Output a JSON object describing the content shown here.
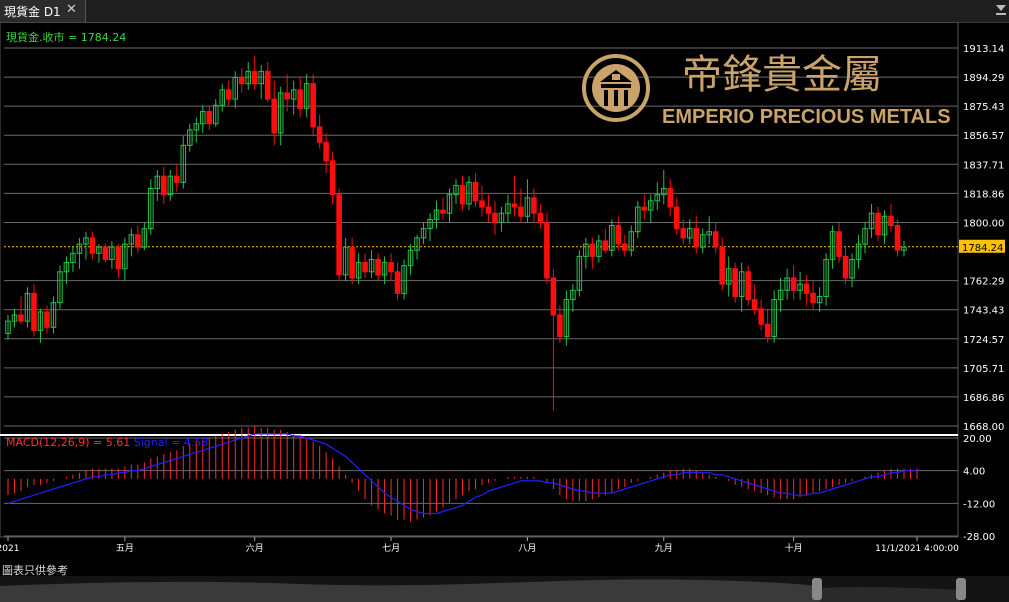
{
  "window": {
    "tab_title": "現貨金 D1",
    "close_glyph": "✕",
    "collapse_icon": "chevron-down-icon"
  },
  "logo": {
    "chinese": "帝鋒貴金屬",
    "english": "EMPERIO PRECIOUS METALS",
    "color": "#c9a36a"
  },
  "disclaimer": "圖表只供參考",
  "colors": {
    "up": "#22c24a",
    "down": "#ff0d0d",
    "macd_hist": "#ff2a2a",
    "signal": "#2020ff",
    "grid": "#6a6a6a",
    "price_line": "#ffc000",
    "axis_text": "#ffffff",
    "legend_green": "#3ad63a"
  },
  "chart_data": [
    {
      "type": "candlestick",
      "symbol": "現貨金",
      "timeframe": "D1",
      "legend": "現貨金.收市 = 1784.24",
      "last_price": 1784.24,
      "last_price_label": "1784.24",
      "y_ticks": [
        "1913.14",
        "1894.29",
        "1875.43",
        "1856.57",
        "1837.71",
        "1818.86",
        "1800.00",
        "1784.24",
        "1762.29",
        "1743.43",
        "1724.57",
        "1705.71",
        "1686.86",
        "1668.00"
      ],
      "ylim": [
        1668.0,
        1913.14
      ],
      "x_labels": [
        {
          "label": "2021",
          "index": 0
        },
        {
          "label": "五月",
          "index": 18
        },
        {
          "label": "六月",
          "index": 38
        },
        {
          "label": "七月",
          "index": 59
        },
        {
          "label": "八月",
          "index": 80
        },
        {
          "label": "九月",
          "index": 101
        },
        {
          "label": "十月",
          "index": 121
        },
        {
          "label": "11/1/2021 4:00:00",
          "index": 140
        }
      ],
      "candles": [
        [
          1728,
          1740,
          1724,
          1736
        ],
        [
          1736,
          1744,
          1732,
          1740
        ],
        [
          1740,
          1752,
          1734,
          1736
        ],
        [
          1736,
          1758,
          1732,
          1754
        ],
        [
          1754,
          1760,
          1726,
          1730
        ],
        [
          1730,
          1744,
          1722,
          1742
        ],
        [
          1742,
          1746,
          1728,
          1732
        ],
        [
          1732,
          1752,
          1728,
          1748
        ],
        [
          1748,
          1772,
          1744,
          1768
        ],
        [
          1768,
          1778,
          1760,
          1774
        ],
        [
          1774,
          1784,
          1768,
          1780
        ],
        [
          1780,
          1790,
          1770,
          1786
        ],
        [
          1786,
          1794,
          1776,
          1790
        ],
        [
          1790,
          1794,
          1776,
          1780
        ],
        [
          1780,
          1786,
          1774,
          1784
        ],
        [
          1784,
          1786,
          1774,
          1776
        ],
        [
          1776,
          1788,
          1770,
          1784
        ],
        [
          1784,
          1786,
          1764,
          1770
        ],
        [
          1770,
          1790,
          1762,
          1786
        ],
        [
          1786,
          1796,
          1778,
          1792
        ],
        [
          1792,
          1798,
          1780,
          1784
        ],
        [
          1784,
          1800,
          1782,
          1796
        ],
        [
          1796,
          1828,
          1792,
          1822
        ],
        [
          1822,
          1834,
          1814,
          1830
        ],
        [
          1830,
          1836,
          1812,
          1818
        ],
        [
          1818,
          1834,
          1814,
          1830
        ],
        [
          1830,
          1838,
          1820,
          1826
        ],
        [
          1826,
          1856,
          1822,
          1850
        ],
        [
          1850,
          1864,
          1846,
          1860
        ],
        [
          1860,
          1868,
          1852,
          1864
        ],
        [
          1864,
          1876,
          1858,
          1872
        ],
        [
          1872,
          1876,
          1860,
          1864
        ],
        [
          1864,
          1880,
          1862,
          1876
        ],
        [
          1876,
          1890,
          1872,
          1886
        ],
        [
          1886,
          1892,
          1876,
          1880
        ],
        [
          1880,
          1898,
          1874,
          1894
        ],
        [
          1894,
          1900,
          1884,
          1890
        ],
        [
          1890,
          1904,
          1886,
          1898
        ],
        [
          1898,
          1908,
          1886,
          1890
        ],
        [
          1890,
          1902,
          1880,
          1898
        ],
        [
          1898,
          1904,
          1878,
          1880
        ],
        [
          1880,
          1892,
          1850,
          1858
        ],
        [
          1858,
          1888,
          1850,
          1884
        ],
        [
          1884,
          1896,
          1872,
          1880
        ],
        [
          1880,
          1892,
          1870,
          1886
        ],
        [
          1886,
          1894,
          1868,
          1874
        ],
        [
          1874,
          1896,
          1868,
          1890
        ],
        [
          1890,
          1896,
          1856,
          1862
        ],
        [
          1862,
          1870,
          1848,
          1852
        ],
        [
          1852,
          1858,
          1832,
          1840
        ],
        [
          1840,
          1846,
          1812,
          1818
        ],
        [
          1818,
          1822,
          1762,
          1766
        ],
        [
          1766,
          1790,
          1762,
          1784
        ],
        [
          1784,
          1790,
          1760,
          1764
        ],
        [
          1764,
          1780,
          1760,
          1774
        ],
        [
          1774,
          1780,
          1764,
          1768
        ],
        [
          1768,
          1782,
          1764,
          1776
        ],
        [
          1776,
          1780,
          1762,
          1766
        ],
        [
          1766,
          1778,
          1760,
          1774
        ],
        [
          1774,
          1780,
          1762,
          1768
        ],
        [
          1768,
          1774,
          1750,
          1754
        ],
        [
          1754,
          1776,
          1750,
          1772
        ],
        [
          1772,
          1786,
          1766,
          1782
        ],
        [
          1782,
          1792,
          1776,
          1790
        ],
        [
          1790,
          1800,
          1786,
          1796
        ],
        [
          1796,
          1806,
          1788,
          1802
        ],
        [
          1802,
          1814,
          1796,
          1808
        ],
        [
          1808,
          1816,
          1802,
          1806
        ],
        [
          1806,
          1822,
          1800,
          1818
        ],
        [
          1818,
          1828,
          1812,
          1824
        ],
        [
          1824,
          1830,
          1808,
          1812
        ],
        [
          1812,
          1830,
          1808,
          1826
        ],
        [
          1826,
          1832,
          1810,
          1814
        ],
        [
          1814,
          1824,
          1804,
          1810
        ],
        [
          1810,
          1818,
          1800,
          1806
        ],
        [
          1806,
          1814,
          1792,
          1800
        ],
        [
          1800,
          1810,
          1794,
          1806
        ],
        [
          1806,
          1818,
          1800,
          1812
        ],
        [
          1812,
          1830,
          1804,
          1810
        ],
        [
          1810,
          1822,
          1800,
          1804
        ],
        [
          1804,
          1828,
          1800,
          1816
        ],
        [
          1816,
          1822,
          1800,
          1806
        ],
        [
          1806,
          1812,
          1796,
          1800
        ],
        [
          1800,
          1806,
          1760,
          1764
        ],
        [
          1764,
          1770,
          1678,
          1740
        ],
        [
          1740,
          1746,
          1722,
          1726
        ],
        [
          1726,
          1756,
          1720,
          1750
        ],
        [
          1750,
          1760,
          1742,
          1756
        ],
        [
          1756,
          1782,
          1752,
          1778
        ],
        [
          1778,
          1790,
          1770,
          1786
        ],
        [
          1786,
          1790,
          1770,
          1778
        ],
        [
          1778,
          1792,
          1774,
          1788
        ],
        [
          1788,
          1796,
          1780,
          1782
        ],
        [
          1782,
          1802,
          1778,
          1798
        ],
        [
          1798,
          1804,
          1782,
          1786
        ],
        [
          1786,
          1792,
          1778,
          1782
        ],
        [
          1782,
          1798,
          1778,
          1794
        ],
        [
          1794,
          1814,
          1790,
          1810
        ],
        [
          1810,
          1818,
          1802,
          1808
        ],
        [
          1808,
          1818,
          1800,
          1814
        ],
        [
          1814,
          1826,
          1808,
          1818
        ],
        [
          1818,
          1834,
          1812,
          1822
        ],
        [
          1822,
          1828,
          1804,
          1810
        ],
        [
          1810,
          1816,
          1792,
          1796
        ],
        [
          1796,
          1802,
          1786,
          1790
        ],
        [
          1790,
          1802,
          1786,
          1796
        ],
        [
          1796,
          1804,
          1780,
          1784
        ],
        [
          1784,
          1796,
          1780,
          1792
        ],
        [
          1792,
          1804,
          1786,
          1794
        ],
        [
          1794,
          1800,
          1780,
          1784
        ],
        [
          1784,
          1790,
          1756,
          1760
        ],
        [
          1760,
          1778,
          1752,
          1770
        ],
        [
          1770,
          1774,
          1748,
          1752
        ],
        [
          1752,
          1774,
          1742,
          1768
        ],
        [
          1768,
          1772,
          1746,
          1750
        ],
        [
          1750,
          1760,
          1740,
          1744
        ],
        [
          1744,
          1750,
          1730,
          1734
        ],
        [
          1734,
          1744,
          1722,
          1726
        ],
        [
          1726,
          1756,
          1722,
          1750
        ],
        [
          1750,
          1764,
          1742,
          1756
        ],
        [
          1756,
          1770,
          1750,
          1764
        ],
        [
          1764,
          1772,
          1750,
          1756
        ],
        [
          1756,
          1768,
          1750,
          1760
        ],
        [
          1760,
          1766,
          1746,
          1754
        ],
        [
          1754,
          1762,
          1744,
          1748
        ],
        [
          1748,
          1758,
          1742,
          1752
        ],
        [
          1752,
          1780,
          1746,
          1776
        ],
        [
          1776,
          1798,
          1770,
          1794
        ],
        [
          1794,
          1800,
          1774,
          1778
        ],
        [
          1778,
          1784,
          1760,
          1764
        ],
        [
          1764,
          1780,
          1758,
          1776
        ],
        [
          1776,
          1792,
          1770,
          1786
        ],
        [
          1786,
          1800,
          1780,
          1796
        ],
        [
          1796,
          1812,
          1790,
          1806
        ],
        [
          1806,
          1810,
          1788,
          1792
        ],
        [
          1792,
          1808,
          1786,
          1804
        ],
        [
          1804,
          1812,
          1794,
          1798
        ],
        [
          1798,
          1802,
          1778,
          1782
        ],
        [
          1782,
          1788,
          1778,
          1784
        ]
      ]
    },
    {
      "type": "bar+line",
      "title": "MACD(12,26,9) = 5.61",
      "signal_label": "Signal = 4.58",
      "macd_value": 5.61,
      "signal_value": 4.58,
      "y_ticks": [
        "20.00",
        "4.00",
        "-12.00",
        "-28.00"
      ],
      "ylim": [
        -28,
        20
      ],
      "macd_hist": [
        -8,
        -7,
        -6,
        -4,
        -3,
        -3,
        -2,
        -1,
        0,
        1,
        2,
        3,
        4,
        5,
        5,
        5,
        5,
        5,
        6,
        7,
        7,
        8,
        10,
        11,
        12,
        13,
        14,
        16,
        17,
        18,
        19,
        20,
        21,
        22,
        23,
        24,
        25,
        25,
        26,
        25,
        25,
        24,
        24,
        23,
        22,
        21,
        20,
        18,
        16,
        13,
        10,
        6,
        2,
        -2,
        -6,
        -10,
        -13,
        -15,
        -17,
        -18,
        -20,
        -20,
        -21,
        -20,
        -19,
        -18,
        -16,
        -14,
        -12,
        -10,
        -8,
        -6,
        -5,
        -3,
        -2,
        -1,
        0,
        1,
        1,
        1,
        1,
        1,
        0,
        -2,
        -5,
        -8,
        -10,
        -11,
        -11,
        -11,
        -10,
        -9,
        -8,
        -7,
        -5,
        -4,
        -2,
        -1,
        0,
        1,
        2,
        3,
        4,
        4,
        5,
        5,
        4,
        3,
        2,
        1,
        0,
        -1,
        -3,
        -4,
        -5,
        -6,
        -7,
        -8,
        -9,
        -10,
        -10,
        -10,
        -9,
        -8,
        -7,
        -6,
        -5,
        -4,
        -3,
        -2,
        -1,
        0,
        1,
        2,
        3,
        4,
        5,
        5,
        5,
        5,
        5
      ],
      "signal": [
        -12,
        -11,
        -10,
        -9,
        -8,
        -7,
        -6,
        -5,
        -4,
        -3,
        -2,
        -1,
        0,
        1,
        1,
        2,
        2,
        3,
        3,
        4,
        4,
        5,
        6,
        7,
        8,
        9,
        10,
        11,
        12,
        13,
        14,
        15,
        16,
        17,
        18,
        19,
        20,
        21,
        22,
        22,
        22,
        22,
        22,
        22,
        21,
        21,
        20,
        19,
        18,
        17,
        15,
        13,
        11,
        8,
        5,
        2,
        -1,
        -4,
        -7,
        -9,
        -11,
        -13,
        -15,
        -16,
        -17,
        -17,
        -17,
        -16,
        -15,
        -14,
        -13,
        -11,
        -9,
        -8,
        -6,
        -5,
        -4,
        -3,
        -2,
        -1,
        -1,
        -1,
        -1,
        -2,
        -2,
        -3,
        -4,
        -5,
        -6,
        -6,
        -7,
        -7,
        -7,
        -7,
        -6,
        -5,
        -4,
        -3,
        -2,
        -1,
        0,
        1,
        2,
        2,
        3,
        3,
        3,
        3,
        3,
        2,
        2,
        1,
        0,
        -1,
        -2,
        -3,
        -4,
        -5,
        -6,
        -7,
        -7,
        -8,
        -8,
        -8,
        -7,
        -7,
        -6,
        -5,
        -4,
        -3,
        -2,
        -1,
        0,
        1,
        1,
        2,
        3,
        3,
        4,
        4,
        4
      ]
    }
  ]
}
